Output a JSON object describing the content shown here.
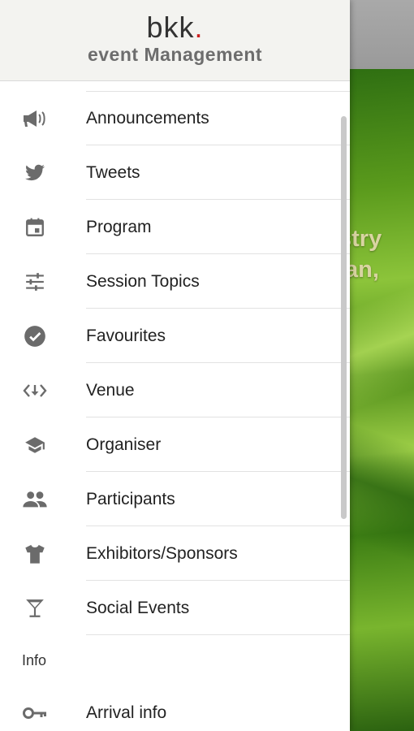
{
  "header": {
    "logo_main": "bkk",
    "logo_dot": ".",
    "logo_sub": "event Management"
  },
  "menu": {
    "items": [
      {
        "label": "Announcements",
        "icon": "megaphone-icon"
      },
      {
        "label": "Tweets",
        "icon": "twitter-bird-icon"
      },
      {
        "label": "Program",
        "icon": "calendar-icon"
      },
      {
        "label": "Session Topics",
        "icon": "sliders-icon"
      },
      {
        "label": "Favourites",
        "icon": "check-circle-icon"
      },
      {
        "label": "Venue",
        "icon": "venue-arrows-icon"
      },
      {
        "label": "Organiser",
        "icon": "graduation-cap-icon"
      },
      {
        "label": "Participants",
        "icon": "people-icon"
      },
      {
        "label": "Exhibitors/Sponsors",
        "icon": "tshirt-icon"
      },
      {
        "label": "Social Events",
        "icon": "cocktail-glass-icon"
      }
    ],
    "section_info": "Info",
    "info_items": [
      {
        "label": "Arrival info",
        "icon": "key-icon"
      }
    ]
  },
  "background": {
    "hero_line1": "stry",
    "hero_line2": "lan,"
  },
  "colors": {
    "icon": "#6b6b6b",
    "text": "#222222",
    "logo_dot": "#cc1f1f",
    "header_bg": "#f3f3f0"
  }
}
